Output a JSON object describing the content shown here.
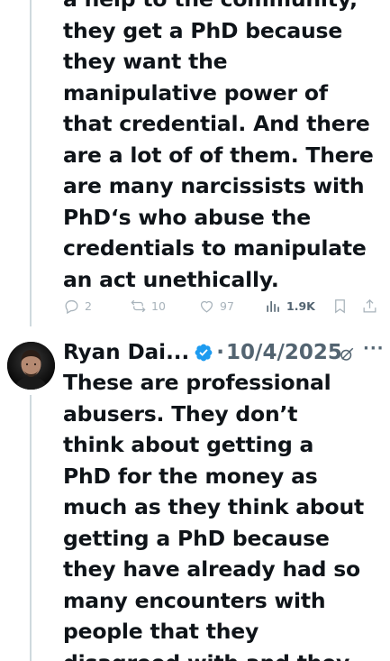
{
  "tweet1": {
    "lines": [
      "a help to the community,",
      "they get a PhD because",
      "they want the",
      "manipulative power of",
      "that credential. And there",
      "are a lot of of them. There",
      "are many narcissists with",
      "PhD‘s who abuse the",
      "credentials to manipulate",
      "an act unethically."
    ],
    "actions": {
      "replies": "2",
      "reposts": "10",
      "likes": "97",
      "views": "1.9K"
    }
  },
  "tweet2": {
    "author_name": "Ryan Dai...",
    "separator": "·",
    "date": "10/4/2025",
    "more": "···",
    "lines": [
      "These are professional",
      "abusers. They don’t",
      "think about getting a",
      "PhD for the money as",
      "much as they think about",
      "getting a PhD because",
      "they have already had so",
      "many encounters with",
      "people that they",
      "disagreed with and they"
    ]
  },
  "colors": {
    "text": "#0f1419",
    "muted": "#536471",
    "action_icon": "#a8b3bb",
    "verified": "#1d9bf0",
    "thread_line": "#cfd9de"
  },
  "icons": {
    "reply": "reply-icon",
    "repost": "repost-icon",
    "like": "heart-icon",
    "views": "views-icon",
    "bookmark": "bookmark-icon",
    "share": "share-icon",
    "verified": "verified-badge-icon",
    "grok": "grok-icon"
  }
}
